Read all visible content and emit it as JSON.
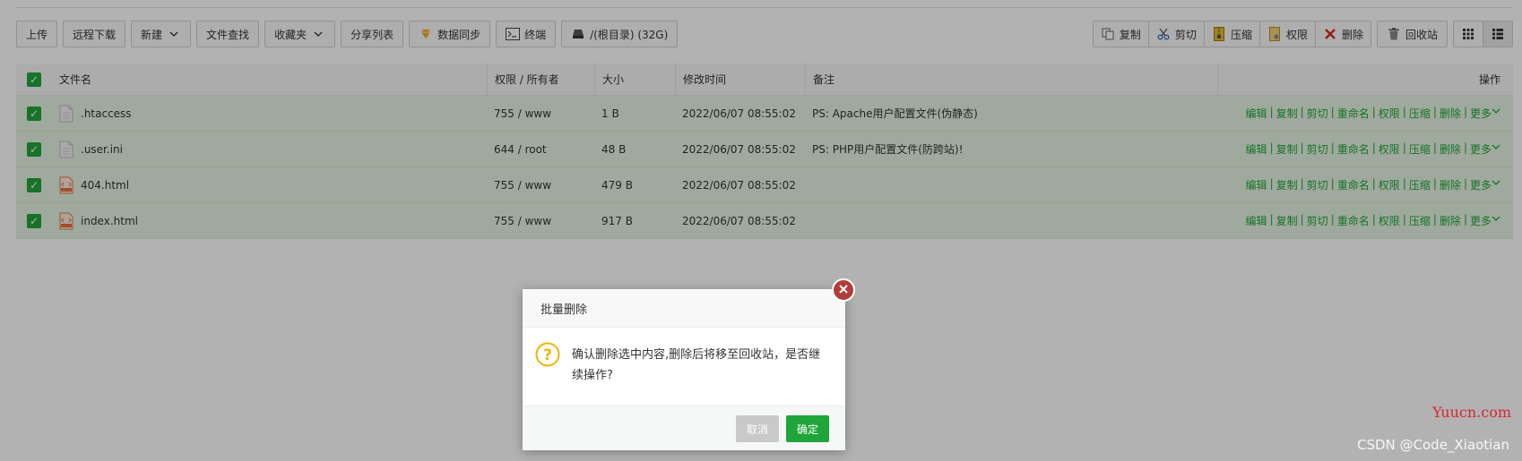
{
  "toolbar": {
    "upload": "上传",
    "remote_download": "远程下载",
    "new": "新建",
    "file_search": "文件查找",
    "favorites": "收藏夹",
    "share_list": "分享列表",
    "data_sync": "数据同步",
    "terminal": "终端",
    "path": "/(根目录) (32G)",
    "copy": "复制",
    "cut": "剪切",
    "compress": "压缩",
    "permission": "权限",
    "delete": "删除",
    "recycle_bin": "回收站"
  },
  "table": {
    "headers": {
      "name": "文件名",
      "perm": "权限 / 所有者",
      "size": "大小",
      "mtime": "修改时间",
      "note": "备注",
      "ops": "操作"
    },
    "rows": [
      {
        "name": ".htaccess",
        "perm": "755 / www",
        "size": "1 B",
        "mtime": "2022/06/07 08:55:02",
        "note": "PS: Apache用户配置文件(伪静态)",
        "icon": "file-icon"
      },
      {
        "name": ".user.ini",
        "perm": "644 / root",
        "size": "48 B",
        "mtime": "2022/06/07 08:55:02",
        "note": "PS: PHP用户配置文件(防跨站)!",
        "icon": "file-icon"
      },
      {
        "name": "404.html",
        "perm": "755 / www",
        "size": "479 B",
        "mtime": "2022/06/07 08:55:02",
        "note": "",
        "icon": "html-file-icon"
      },
      {
        "name": "index.html",
        "perm": "755 / www",
        "size": "917 B",
        "mtime": "2022/06/07 08:55:02",
        "note": "",
        "icon": "html-file-icon"
      }
    ],
    "ops": {
      "edit": "编辑",
      "copy": "复制",
      "cut": "剪切",
      "rename": "重命名",
      "perm": "权限",
      "compress": "压缩",
      "delete": "删除",
      "more": "更多"
    }
  },
  "dialog": {
    "title": "批量删除",
    "message": "确认删除选中内容,删除后将移至回收站，是否继续操作?",
    "cancel": "取消",
    "confirm": "确定"
  },
  "watermarks": {
    "site": "Yuucn.com",
    "author": "CSDN @Code_Xiaotian"
  },
  "colors": {
    "accent": "#20a53a",
    "danger": "#b23b3b",
    "row_selected": "#e6f3e2"
  }
}
